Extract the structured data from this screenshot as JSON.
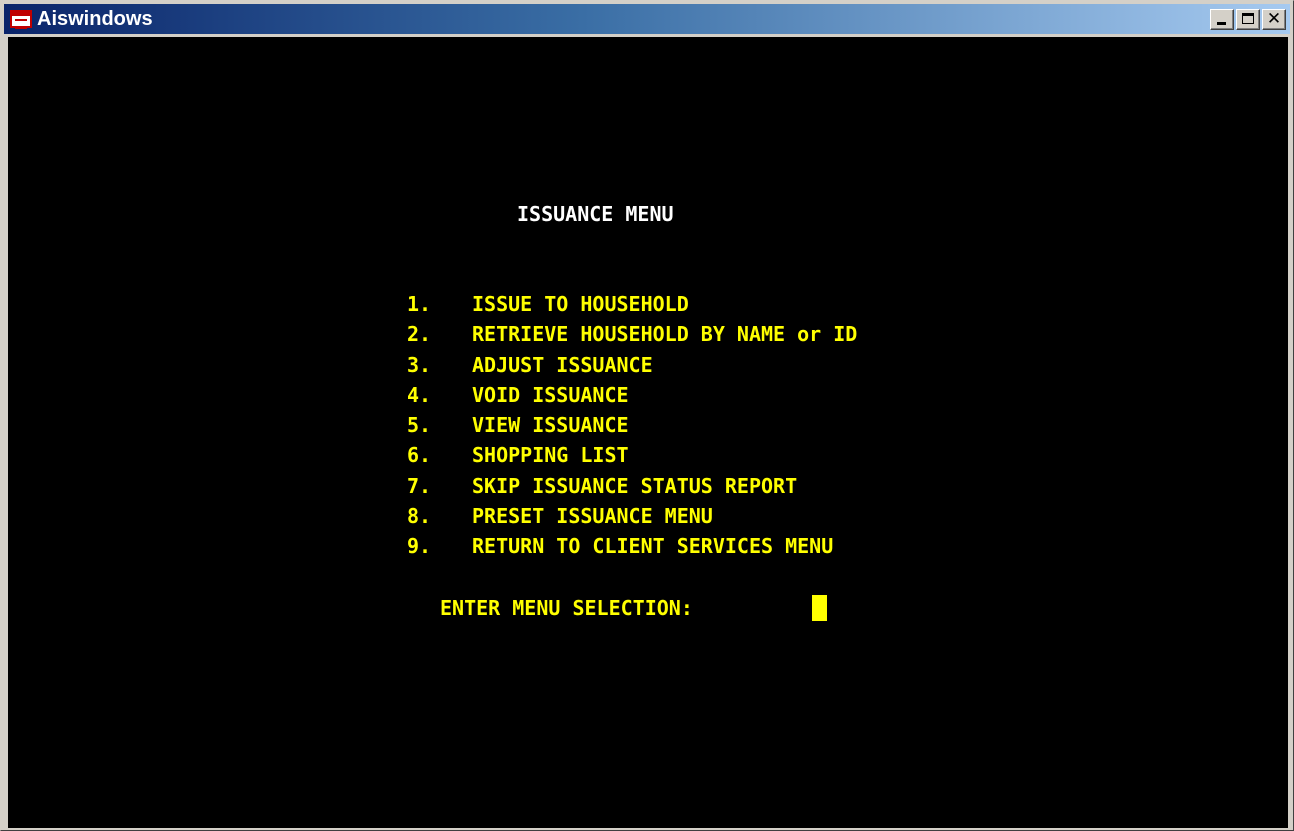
{
  "window": {
    "title": "Aiswindows",
    "icon": "app-window-icon",
    "controls": [
      "minimize-icon",
      "maximize-icon",
      "close-icon"
    ],
    "close_glyph": "✕"
  },
  "screen": {
    "background": "#000000",
    "text_color": "#ffff00",
    "title_color": "#ffffff",
    "menu_title": "ISSUANCE MENU",
    "items": [
      {
        "num": "1.",
        "label": "ISSUE TO HOUSEHOLD"
      },
      {
        "num": "2.",
        "label": "RETRIEVE HOUSEHOLD BY NAME or ID"
      },
      {
        "num": "3.",
        "label": "ADJUST ISSUANCE"
      },
      {
        "num": "4.",
        "label": "VOID ISSUANCE"
      },
      {
        "num": "5.",
        "label": "VIEW ISSUANCE"
      },
      {
        "num": "6.",
        "label": "SHOPPING LIST"
      },
      {
        "num": "7.",
        "label": "SKIP ISSUANCE STATUS REPORT"
      },
      {
        "num": "8.",
        "label": "PRESET ISSUANCE MENU"
      },
      {
        "num": "9.",
        "label": "RETURN TO CLIENT SERVICES MENU"
      }
    ],
    "prompt": "ENTER MENU SELECTION:",
    "input_value": ""
  }
}
